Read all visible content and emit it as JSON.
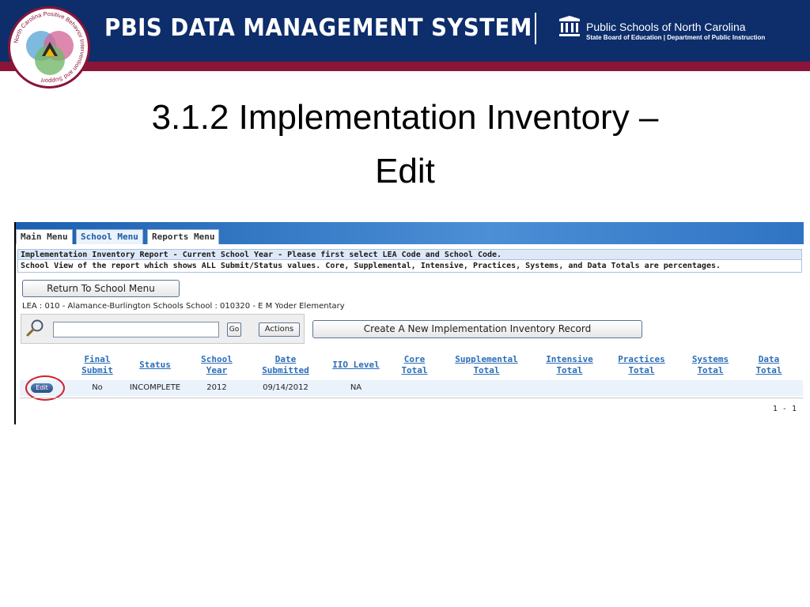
{
  "header": {
    "system_title": "PBIS DATA MANAGEMENT SYSTEM",
    "org_name": "Public Schools of North Carolina",
    "org_subtitle": "State Board of Education | Department of Public Instruction",
    "logo_text": "North Carolina Positive Behavior Intervention and Support",
    "colors": {
      "banner": "#0d2d6b",
      "stripe": "#8a1538"
    }
  },
  "slide": {
    "title_line1": "3.1.2 Implementation Inventory –",
    "title_line2": "Edit"
  },
  "app": {
    "tabs": [
      {
        "label": "Main Menu",
        "active": false
      },
      {
        "label": "School Menu",
        "active": true
      },
      {
        "label": "Reports Menu",
        "active": false
      }
    ],
    "report_header": "Implementation Inventory Report - Current School Year - Please first select LEA Code and School Code.",
    "report_desc": "School View of the report which shows ALL Submit/Status values. Core, Supplemental, Intensive, Practices, Systems, and Data Totals are percentages.",
    "return_button": "Return To School Menu",
    "lea_line": "LEA : 010 - Alamance-Burlington Schools School : 010320 - E M Yoder Elementary",
    "search": {
      "value": "",
      "go_label": "Go",
      "actions_label": "Actions"
    },
    "create_button": "Create A New Implementation Inventory Record",
    "table": {
      "columns": [
        {
          "l1": "Final",
          "l2": "Submit"
        },
        {
          "l1": "Status",
          "l2": ""
        },
        {
          "l1": "School",
          "l2": "Year"
        },
        {
          "l1": "Date",
          "l2": "Submitted"
        },
        {
          "l1": "IIO Level",
          "l2": ""
        },
        {
          "l1": "Core",
          "l2": "Total"
        },
        {
          "l1": "Supplemental",
          "l2": "Total"
        },
        {
          "l1": "Intensive",
          "l2": "Total"
        },
        {
          "l1": "Practices",
          "l2": "Total"
        },
        {
          "l1": "Systems",
          "l2": "Total"
        },
        {
          "l1": "Data",
          "l2": "Total"
        }
      ],
      "rows": [
        {
          "edit": "Edit",
          "final_submit": "No",
          "status": "INCOMPLETE",
          "school_year": "2012",
          "date_submitted": "09/14/2012",
          "iio_level": "NA",
          "core": "",
          "supplemental": "",
          "intensive": "",
          "practices": "",
          "systems": "",
          "data": ""
        }
      ],
      "pager": "1 - 1"
    }
  }
}
